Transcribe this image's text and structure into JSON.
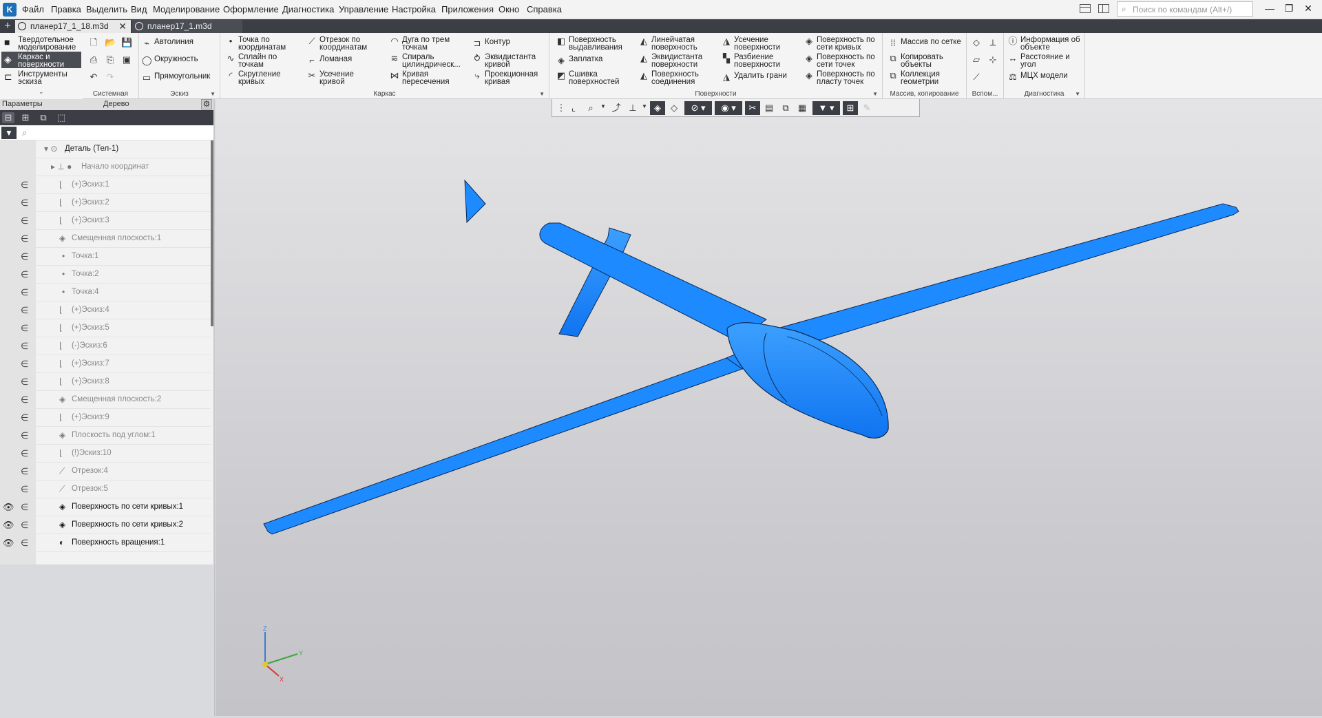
{
  "menubar": {
    "items": [
      "Файл",
      "Правка",
      "Выделить",
      "Вид",
      "Моделирование",
      "Оформление",
      "Диагностика",
      "Управление",
      "Настройка",
      "Приложения",
      "Окно",
      "Справка"
    ],
    "search_placeholder": "Поиск по командам (Alt+/)"
  },
  "tabs": [
    {
      "label": "планер17_1_18.m3d",
      "active": true
    },
    {
      "label": "планер17_1.m3d",
      "active": false
    }
  ],
  "modes": [
    "Твердотельное\nмоделирование",
    "Каркас и\nповерхности",
    "Инструменты\nэскиза"
  ],
  "ribbon": {
    "groups": {
      "system": "Системная",
      "sketch": "Эскиз",
      "frame": "Каркас",
      "surfaces": "Поверхности",
      "array": "Массив, копирование",
      "aux": "Вспом...",
      "diag": "Диагностика"
    },
    "sketch_buttons": [
      "Автолиния",
      "Окружность",
      "Прямоугольник"
    ],
    "frame_buttons": [
      "Точка по\nкоординатам",
      "Сплайн по\nточкам",
      "Скругление\nкривых",
      "Отрезок по\nкоординатам",
      "Ломаная",
      "Усечение\nкривой",
      "Дуга по трем\nточкам",
      "Спираль\nцилиндрическ...",
      "Кривая\nпересечения",
      "Контур",
      "Эквидистанта\nкривой",
      "Проекционная\nкривая"
    ],
    "surface_buttons": [
      "Поверхность\nвыдавливания",
      "Заплатка",
      "Сшивка\nповерхностей",
      "Линейчатая\nповерхность",
      "Эквидистанта\nповерхности",
      "Поверхность\nсоединения",
      "Усечение\nповерхности",
      "Разбиение\nповерхности",
      "Удалить грани",
      "Поверхность по\nсети кривых",
      "Поверхность по\nсети точек",
      "Поверхность по\nпласту точек"
    ],
    "array_buttons": [
      "Массив по сетке",
      "Копировать\nобъекты",
      "Коллекция\nгеометрии"
    ],
    "diag_buttons": [
      "Информация об\nобъекте",
      "Расстояние и\nугол",
      "МЦХ модели"
    ]
  },
  "panel": {
    "params_label": "Параметры",
    "tree_label": "Дерево"
  },
  "tree": [
    {
      "label": "Деталь (Тел-1)",
      "style": "root",
      "eye": false
    },
    {
      "label": "Начало координат",
      "style": "dim",
      "eye": false
    },
    {
      "label": "(+)Эскиз:1",
      "style": "dim",
      "eye": false
    },
    {
      "label": "(+)Эскиз:2",
      "style": "dim",
      "eye": false
    },
    {
      "label": "(+)Эскиз:3",
      "style": "dim",
      "eye": false
    },
    {
      "label": "Смещенная плоскость:1",
      "style": "dim",
      "eye": false
    },
    {
      "label": "Точка:1",
      "style": "dim",
      "eye": false
    },
    {
      "label": "Точка:2",
      "style": "dim",
      "eye": false
    },
    {
      "label": "Точка:4",
      "style": "dim",
      "eye": false
    },
    {
      "label": "(+)Эскиз:4",
      "style": "dim",
      "eye": false
    },
    {
      "label": "(+)Эскиз:5",
      "style": "dim",
      "eye": false
    },
    {
      "label": "(-)Эскиз:6",
      "style": "dim",
      "eye": false
    },
    {
      "label": "(+)Эскиз:7",
      "style": "dim",
      "eye": false
    },
    {
      "label": "(+)Эскиз:8",
      "style": "dim",
      "eye": false
    },
    {
      "label": "Смещенная плоскость:2",
      "style": "dim",
      "eye": false
    },
    {
      "label": "(+)Эскиз:9",
      "style": "dim",
      "eye": false
    },
    {
      "label": "Плоскость под углом:1",
      "style": "dim",
      "eye": false
    },
    {
      "label": "(!)Эскиз:10",
      "style": "dim",
      "eye": false
    },
    {
      "label": "Отрезок:4",
      "style": "dim",
      "eye": false
    },
    {
      "label": "Отрезок:5",
      "style": "dim",
      "eye": false
    },
    {
      "label": "Поверхность по сети кривых:1",
      "style": "bold",
      "eye": true
    },
    {
      "label": "Поверхность по сети кривых:2",
      "style": "bold",
      "eye": true
    },
    {
      "label": "Поверхность вращения:1",
      "style": "bold",
      "eye": true
    }
  ],
  "axes": {
    "x": "X",
    "y": "Y",
    "z": "Z"
  },
  "colors": {
    "model": "#1e8aff",
    "model_edge": "#0a2a55"
  }
}
